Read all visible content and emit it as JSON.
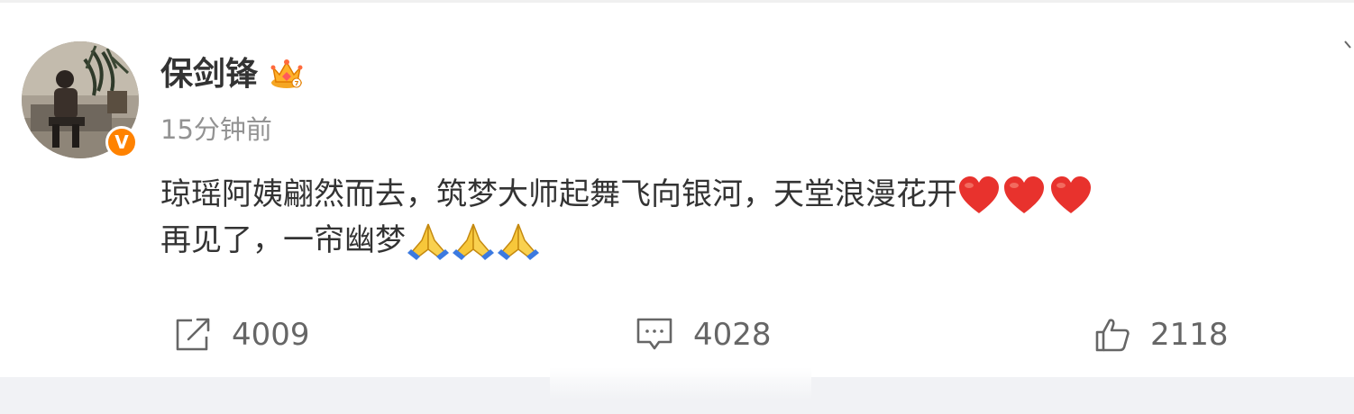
{
  "post": {
    "author": "保剑锋",
    "timestamp": "15分钟前",
    "line1_text": "琼瑶阿姨翩然而去，筑梦大师起舞飞向银河，天堂浪漫花开",
    "line1_emojis": [
      "red-heart",
      "red-heart",
      "red-heart"
    ],
    "line2_text": "再见了，一帘幽梦",
    "line2_emojis": [
      "folded-hands",
      "folded-hands",
      "folded-hands"
    ]
  },
  "actions": {
    "repost_count": "4009",
    "comment_count": "4028",
    "like_count": "2118"
  },
  "icons": {
    "verified": "verified-v-badge",
    "vip": "crown-badge",
    "repost": "share-arrow-icon",
    "comment": "comment-bubble-icon",
    "like": "thumbs-up-icon",
    "menu": "chevron-down-icon"
  },
  "colors": {
    "accent": "#ff8200",
    "text": "#333333",
    "muted": "#939393",
    "heart": "#e8322d",
    "background_bar": "#f1f2f5"
  }
}
